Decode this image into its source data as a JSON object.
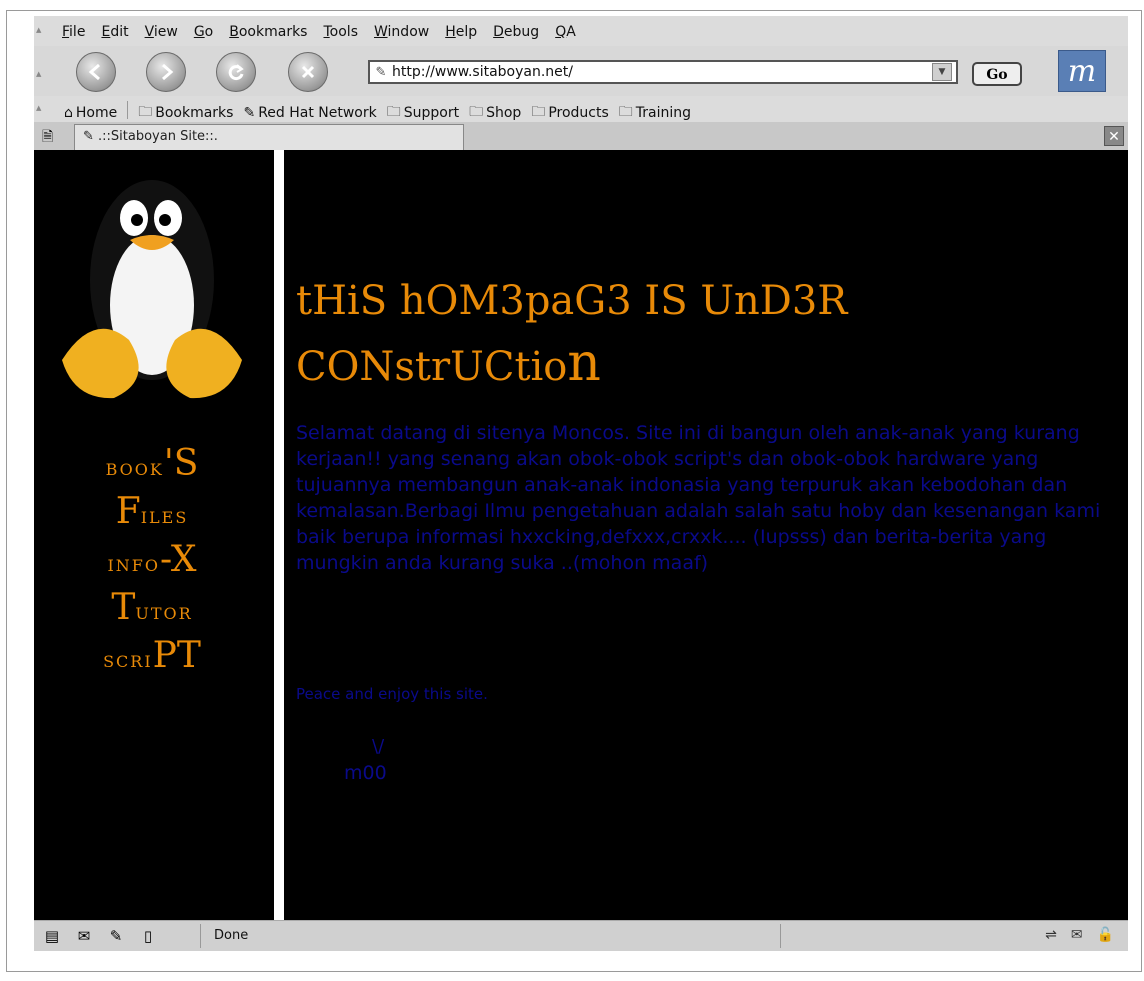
{
  "browser": {
    "menu": [
      "File",
      "Edit",
      "View",
      "Go",
      "Bookmarks",
      "Tools",
      "Window",
      "Help",
      "Debug",
      "QA"
    ],
    "url": "http://www.sitaboyan.net/",
    "go_label": "Go",
    "personal_toolbar": [
      "Home",
      "Bookmarks",
      "Red Hat Network",
      "Support",
      "Shop",
      "Products",
      "Training"
    ],
    "tab_title": ".::Sitaboyan Site::.",
    "status": "Done"
  },
  "page": {
    "sidebar": {
      "book": {
        "small": "BOOK",
        "big": "'S"
      },
      "files": {
        "big": "F",
        "small": "ILES"
      },
      "info": {
        "small": "INFO",
        "big": "-X"
      },
      "tutor": {
        "big": "T",
        "small": "UTOR"
      },
      "script": {
        "small": "SCRI",
        "big": "PT"
      }
    },
    "headline_line1": "tHiS hOM3paG3 IS UnD3R",
    "headline_line2": "CONstrUCtio",
    "headline_last": "n",
    "body": "Selamat datang di sitenya Moncos. Site ini di bangun oleh anak-anak yang kurang kerjaan!! yang senang akan obok-obok script's dan obok-obok hardware yang tujuannya membangun anak-anak indonasia yang terpuruk akan kebodohan dan kemalasan.Berbagi Ilmu pengetahuan adalah salah satu hoby dan kesenangan kami baik berupa informasi hxxcking,defxxx,crxxk.... (Iupsss) dan berita-berita yang mungkin anda kurang suka ..(mohon maaf)",
    "peace": "Peace and enjoy this site.",
    "sig_1": "\\/",
    "sig_2": "m00"
  },
  "colors": {
    "accent_orange": "#e88a08",
    "body_blue": "#0a0a8a",
    "page_bg": "#000000"
  }
}
